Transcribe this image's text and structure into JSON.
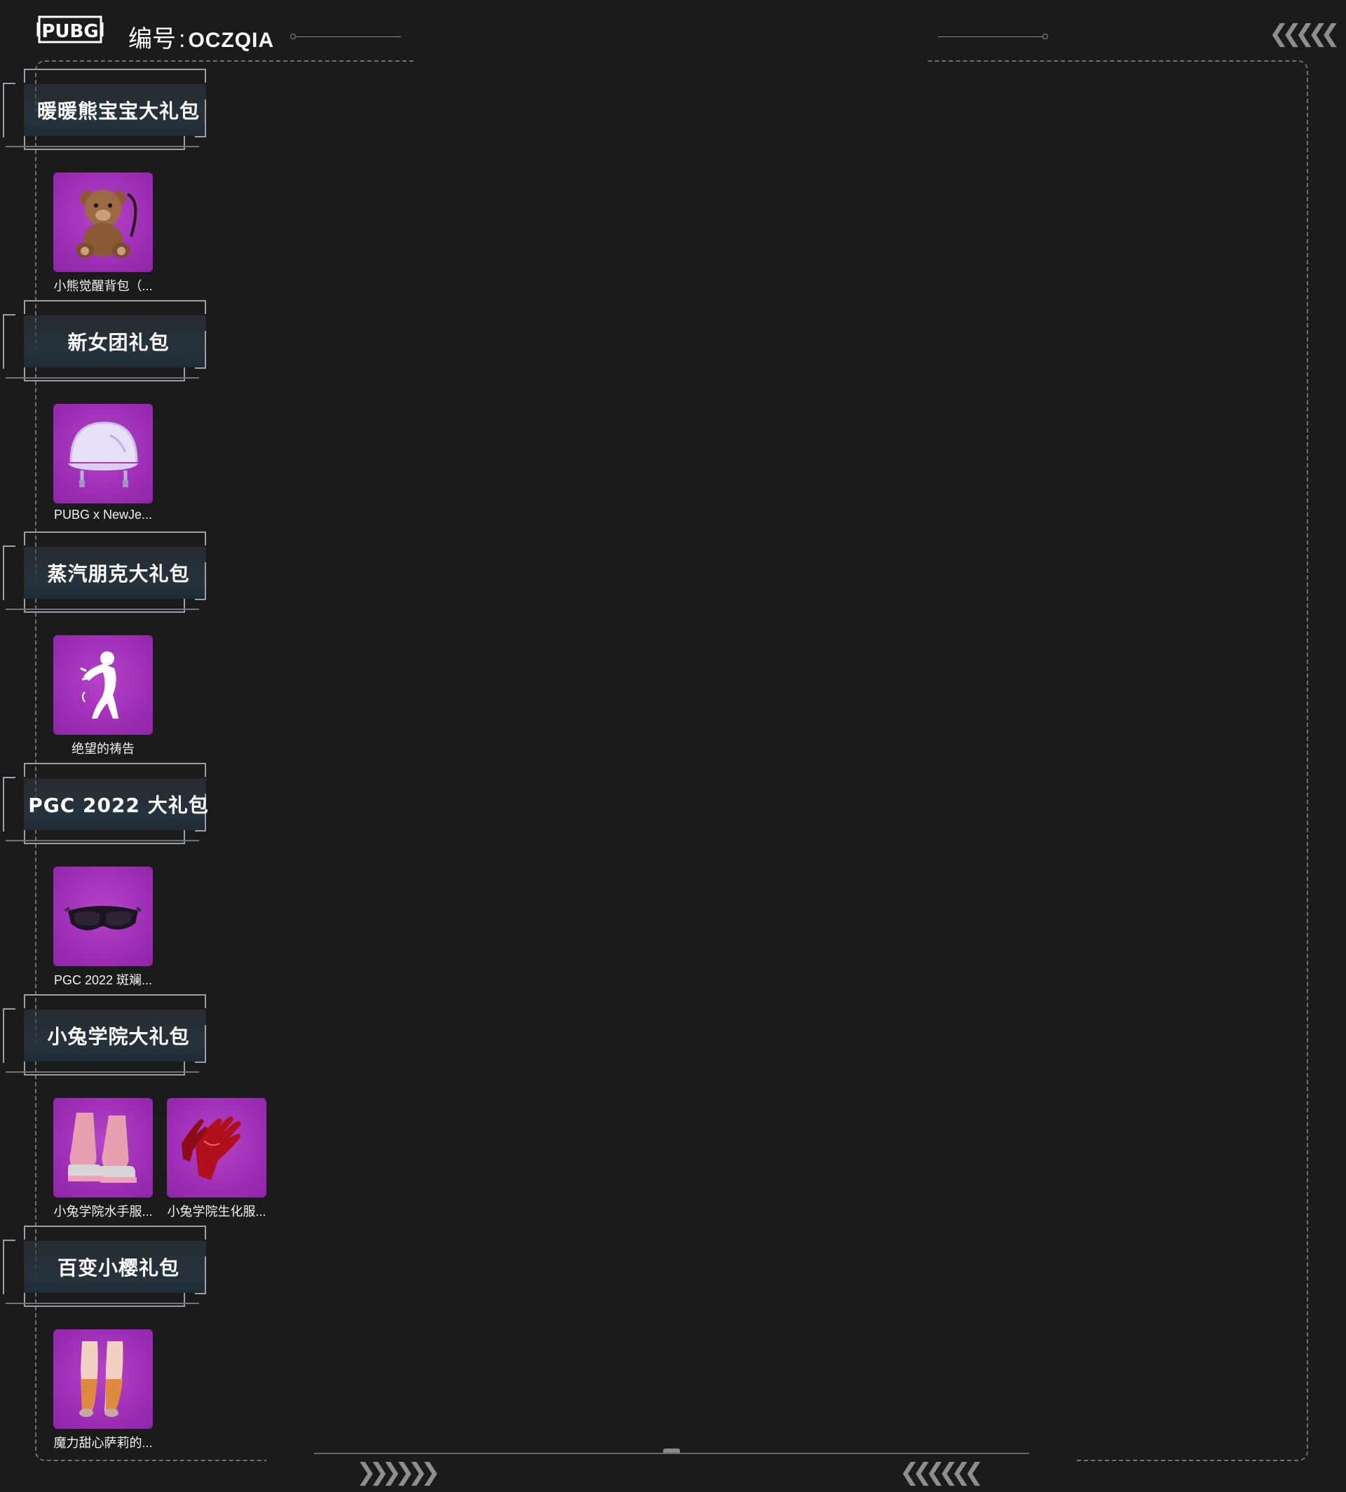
{
  "header": {
    "logo_text": "PUBG",
    "id_label": "编号",
    "id_separator": ":",
    "id_value": "OCZQIA"
  },
  "packages": [
    {
      "title": "暖暖熊宝宝大礼包",
      "items": [
        {
          "name": "小熊觉醒背包（...",
          "icon": "teddy-bear-backpack-icon"
        }
      ]
    },
    {
      "title": "新女团礼包",
      "items": [
        {
          "name": "PUBG x NewJe...",
          "icon": "helmet-icon"
        }
      ]
    },
    {
      "title": "蒸汽朋克大礼包",
      "items": [
        {
          "name": "绝望的祷告",
          "icon": "emote-pose-icon"
        }
      ]
    },
    {
      "title": "PGC 2022 大礼包",
      "items": [
        {
          "name": "PGC 2022 斑斓...",
          "icon": "goggles-icon"
        }
      ]
    },
    {
      "title": "小兔学院大礼包",
      "items": [
        {
          "name": "小兔学院水手服...",
          "icon": "boots-icon"
        },
        {
          "name": "小兔学院生化服...",
          "icon": "gloves-icon"
        }
      ]
    },
    {
      "title": "百变小樱礼包",
      "items": [
        {
          "name": "魔力甜心萨莉的...",
          "icon": "stockings-icon"
        }
      ]
    }
  ],
  "colors": {
    "background": "#1b1b1c",
    "item_tile": "#a030b8",
    "frame": "#707070"
  }
}
